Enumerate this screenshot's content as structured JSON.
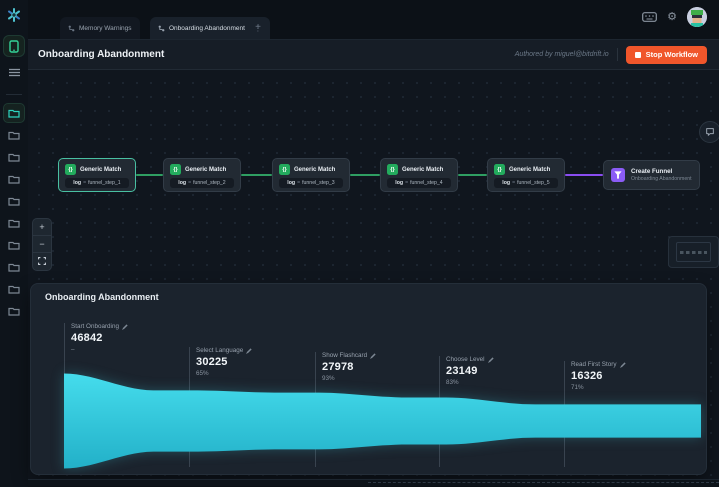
{
  "topbar": {
    "tabs": [
      {
        "label": "Memory Warnings",
        "active": false
      },
      {
        "label": "Onboarding Abandonment",
        "active": true
      }
    ],
    "new_tab": "+",
    "kebab": "⋮",
    "gear": "⚙"
  },
  "header": {
    "title": "Onboarding Abandonment",
    "authored_by": "Authored by miguel@bitdrift.io",
    "stop_button": {
      "label": "Stop Workflow",
      "color": "#f0562b"
    }
  },
  "workflow": {
    "nodes": [
      {
        "title": "Generic Match",
        "field": "log",
        "op": "=",
        "value": "funnel_step_1",
        "selected": true
      },
      {
        "title": "Generic Match",
        "field": "log",
        "op": "=",
        "value": "funnel_step_2",
        "selected": false
      },
      {
        "title": "Generic Match",
        "field": "log",
        "op": "=",
        "value": "funnel_step_3",
        "selected": false
      },
      {
        "title": "Generic Match",
        "field": "log",
        "op": "=",
        "value": "funnel_step_4",
        "selected": false
      },
      {
        "title": "Generic Match",
        "field": "log",
        "op": "=",
        "value": "funnel_step_5",
        "selected": false
      }
    ],
    "create_node": {
      "title": "Create Funnel",
      "subtitle": "Onboarding Abandonment"
    },
    "colors": {
      "match_edge": "#2f9e62",
      "funnel_edge": "#8a4df0",
      "match_icon": "#23ab5d",
      "funnel_icon": "#8b5cf6"
    }
  },
  "canvas_controls": {
    "zoom_in": "+",
    "zoom_out": "−"
  },
  "chart_data": {
    "type": "funnel",
    "title": "Onboarding Abandonment",
    "orientation": "horizontal",
    "stages": [
      {
        "label": "Start Onboarding",
        "value": 46842,
        "percent": "–"
      },
      {
        "label": "Select Language",
        "value": 30225,
        "percent": "65%"
      },
      {
        "label": "Show Flashcard",
        "value": 27978,
        "percent": "93%"
      },
      {
        "label": "Choose Level",
        "value": 23149,
        "percent": "83%"
      },
      {
        "label": "Read First Story",
        "value": 16326,
        "percent": "71%"
      }
    ],
    "colors": {
      "fill_top": "#45dcec",
      "fill_bottom": "#22b0c8"
    }
  }
}
